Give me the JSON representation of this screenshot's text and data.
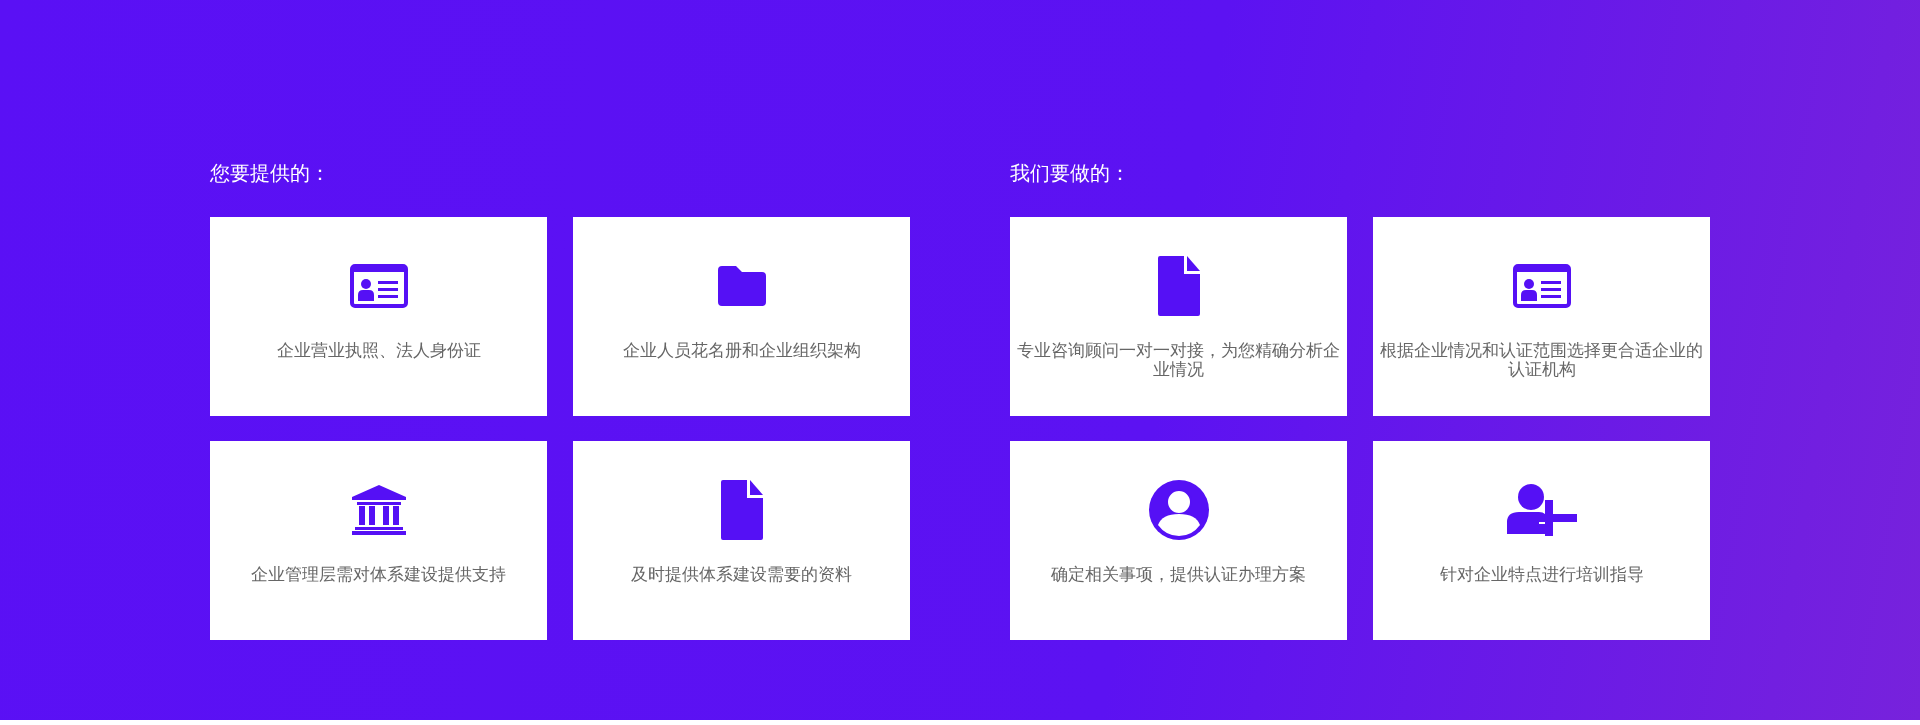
{
  "sections": [
    {
      "heading": "您要提供的：",
      "cards": [
        {
          "kind": "id-card",
          "text": "企业营业执照、法人身份证"
        },
        {
          "kind": "folder",
          "text": "企业人员花名册和企业组织架构"
        },
        {
          "kind": "bank",
          "text": "企业管理层需对体系建设提供支持"
        },
        {
          "kind": "file",
          "text": "及时提供体系建设需要的资料"
        }
      ]
    },
    {
      "heading": "我们要做的：",
      "cards": [
        {
          "kind": "file",
          "text": "专业咨询顾问一对一对接，为您精确分析企业情况"
        },
        {
          "kind": "id-card",
          "text": "根据企业情况和认证范围选择更合适企业的认证机构"
        },
        {
          "kind": "user-circle",
          "text": "确定相关事项，提供认证办理方案"
        },
        {
          "kind": "user-plus",
          "text": "针对企业特点进行培训指导"
        }
      ]
    }
  ]
}
